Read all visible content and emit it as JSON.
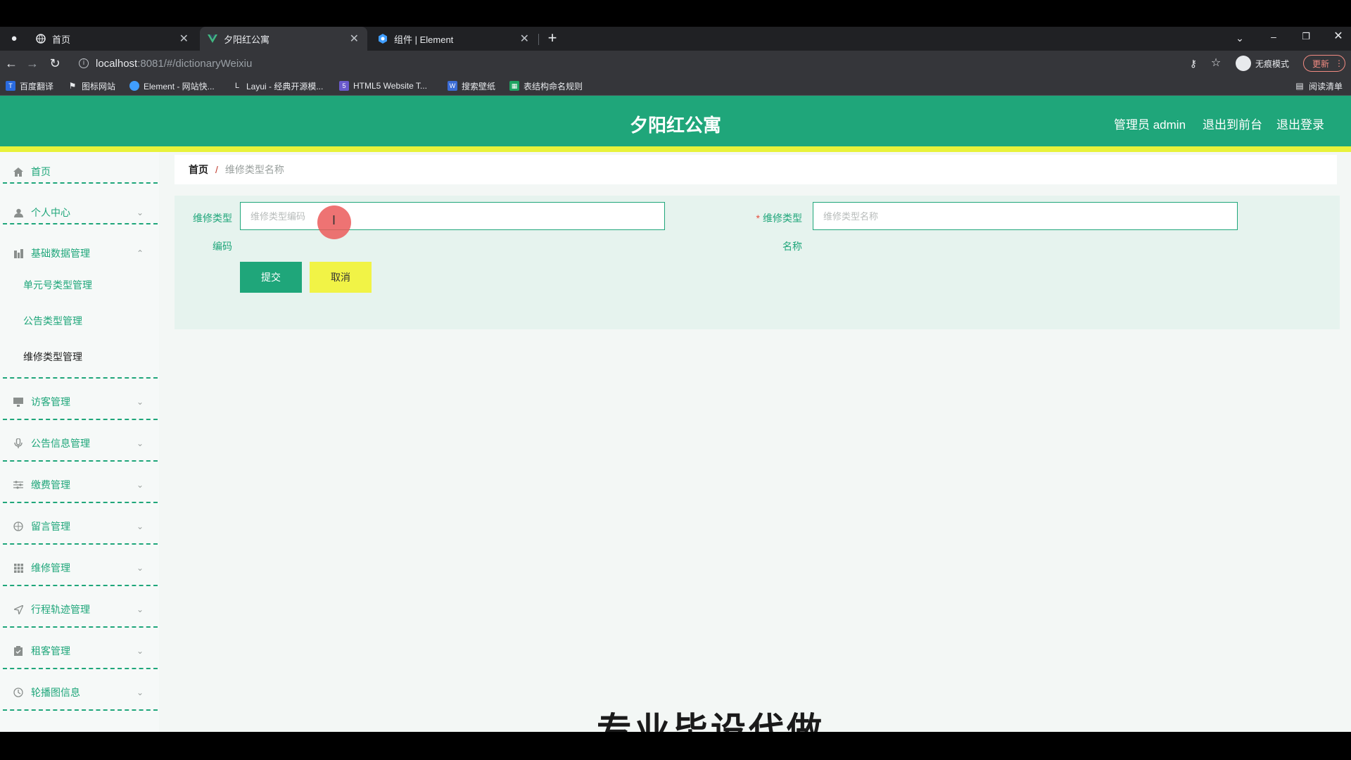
{
  "browser": {
    "tabs": [
      {
        "title": "首页",
        "icon": "globe-icon"
      },
      {
        "title": "夕阳红公寓",
        "icon": "vue-logo-icon"
      },
      {
        "title": "组件 | Element",
        "icon": "element-logo-icon"
      }
    ],
    "url_host": "localhost",
    "url_path": ":8081/#/dictionaryWeixiu",
    "profile_label": "无痕模式",
    "update_label": "更新",
    "reading_list_label": "阅读清单",
    "bookmarks": [
      {
        "label": "百度翻译",
        "icon": "baidu-translate-icon",
        "color": "#2a6be0"
      },
      {
        "label": "图标网站",
        "icon": "flag-icon",
        "color": "#e8eaed"
      },
      {
        "label": "Element - 网站快...",
        "icon": "element-logo-icon",
        "color": "#409eff"
      },
      {
        "label": "Layui - 经典开源模...",
        "icon": "layui-icon",
        "color": "#e8eaed"
      },
      {
        "label": "HTML5 Website T...",
        "icon": "html5-icon",
        "color": "#6a5acd"
      },
      {
        "label": "搜索壁纸",
        "icon": "wallpaper-icon",
        "color": "#3b6cd6"
      },
      {
        "label": "表结构命名规则",
        "icon": "table-icon",
        "color": "#1ea362"
      }
    ]
  },
  "app": {
    "title": "夕阳红公寓",
    "header_links": {
      "admin": "管理员 admin",
      "front": "退出到前台",
      "logout": "退出登录"
    },
    "colors": {
      "primary": "#1fa67a",
      "accent": "#e8f23a",
      "cancel": "#f1f346"
    }
  },
  "sidebar": {
    "home": "首页",
    "personal": "个人中心",
    "basic": "基础数据管理",
    "basic_children": [
      "单元号类型管理",
      "公告类型管理",
      "维修类型管理"
    ],
    "visitor": "访客管理",
    "notice": "公告信息管理",
    "payment": "缴费管理",
    "message": "留言管理",
    "repair": "维修管理",
    "track": "行程轨迹管理",
    "tenant": "租客管理",
    "carousel": "轮播图信息"
  },
  "breadcrumb": {
    "home": "首页",
    "sep": "/",
    "current": "维修类型名称"
  },
  "form": {
    "code_label_line1": "维修类型",
    "code_label_line2": "编码",
    "code_placeholder": "维修类型编码",
    "name_required": "*",
    "name_label_line1": "维修类型",
    "name_label_line2": "名称",
    "name_placeholder": "维修类型名称",
    "submit_label": "提交",
    "cancel_label": "取消"
  },
  "watermark_text": "专业毕设代做"
}
